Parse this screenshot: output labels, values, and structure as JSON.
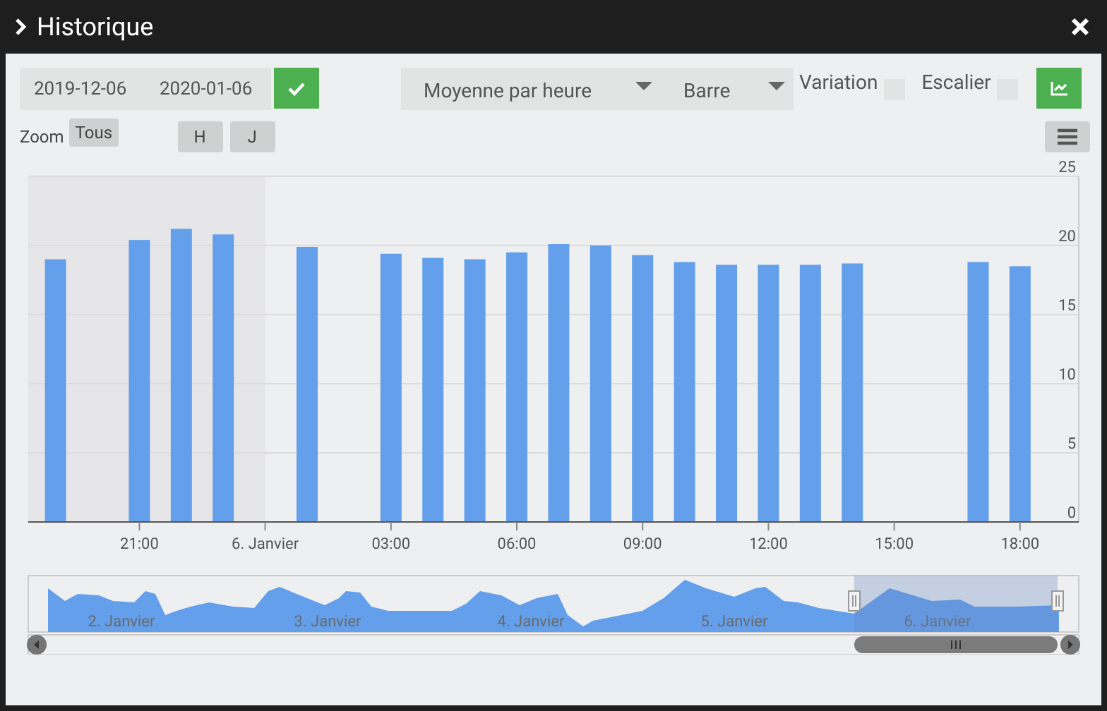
{
  "window": {
    "title": "Historique"
  },
  "toolbar": {
    "start_date": "2019-12-06",
    "end_date": "2020-01-06",
    "aggregation": "Moyenne par heure",
    "chart_type": "Barre",
    "options": [
      {
        "label": "Variation",
        "checked": false
      },
      {
        "label": "Escalier",
        "checked": false
      }
    ]
  },
  "zoom": {
    "label": "Zoom",
    "buttons": [
      "Tous",
      "H",
      "J"
    ]
  },
  "chart": {
    "chart_data": {
      "type": "bar",
      "categories": [
        null,
        null,
        "21:00",
        null,
        null,
        "6. Janvier",
        null,
        null,
        "03:00",
        null,
        null,
        "06:00",
        null,
        null,
        "09:00",
        null,
        null,
        "12:00",
        null,
        null,
        "15:00",
        null,
        null,
        "18:00"
      ],
      "series": [
        {
          "color": "#639fea",
          "values": [
            19.0,
            null,
            20.4,
            21.2,
            20.8,
            null,
            19.9,
            null,
            19.4,
            19.1,
            19.0,
            19.5,
            20.1,
            20.0,
            19.3,
            18.8,
            18.6,
            18.6,
            18.6,
            18.7,
            null,
            null,
            18.8,
            18.5
          ]
        }
      ],
      "ylim": [
        0,
        25
      ],
      "yticks": [
        0,
        5,
        10,
        15,
        20,
        25
      ],
      "grid": true
    }
  },
  "navigator": {
    "labels": [
      "2. Janvier",
      "3. Janvier",
      "4. Janvier",
      "5. Janvier",
      "6. Janvier"
    ]
  }
}
